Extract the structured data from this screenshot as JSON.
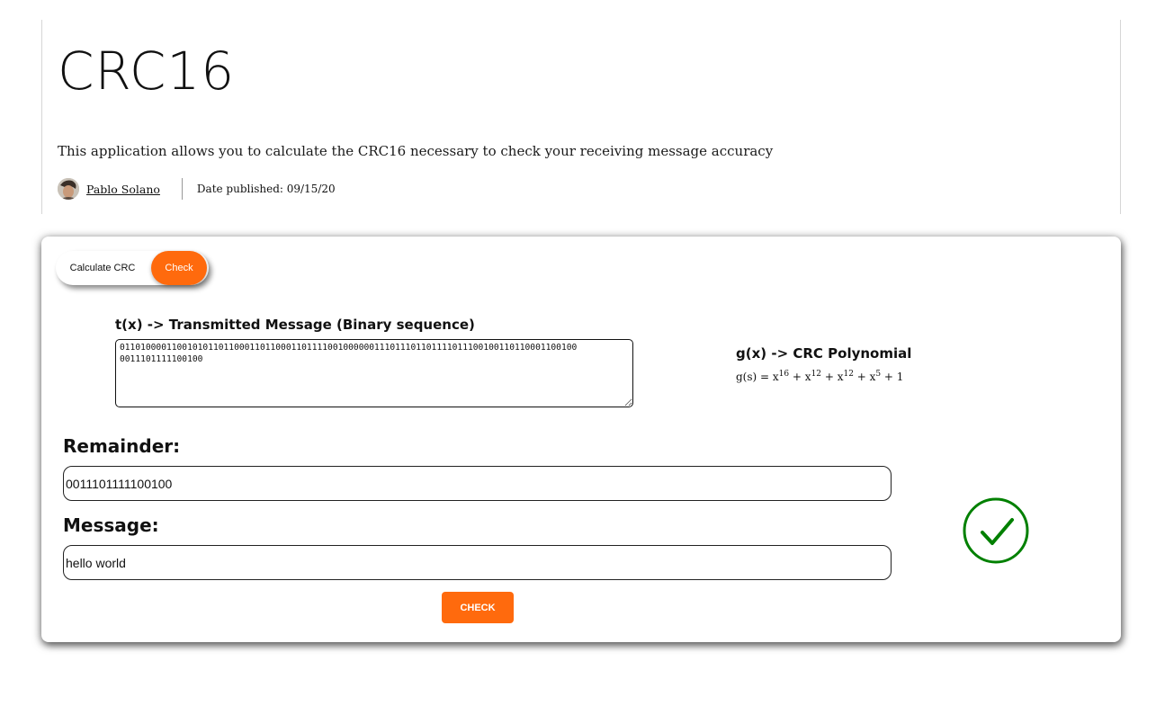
{
  "header": {
    "title": "CRC16",
    "description": "This application allows you to calculate the CRC16 necessary to check your receiving message accuracy",
    "author": "Pablo Solano",
    "date_published": "Date published: 09/15/20"
  },
  "tabs": {
    "calculate_label": "Calculate CRC",
    "check_label": "Check",
    "active": "Check"
  },
  "transmitted": {
    "label": "t(x) -> Transmitted Message (Binary sequence)",
    "value": "0110100001100101011011000110110001101111001000000111011101101111011100100110110001100100 0011101111100100"
  },
  "polynomial": {
    "label": "g(x) -> CRC Polynomial",
    "prefix": "g(s) = x",
    "e1": "16",
    "t2": " + x",
    "e2": "12",
    "t3": " + x",
    "e3": "12",
    "t4": " + x",
    "e4": "5",
    "t5": " + 1"
  },
  "remainder": {
    "label": "Remainder:",
    "value": "0011101111100100"
  },
  "message": {
    "label": "Message:",
    "value": "hello world"
  },
  "check_button": {
    "label": "CHECK"
  },
  "status": {
    "icon": "checkmark-circle-icon",
    "color": "#008000"
  },
  "colors": {
    "accent": "#ff6a0d",
    "success": "#008000"
  }
}
